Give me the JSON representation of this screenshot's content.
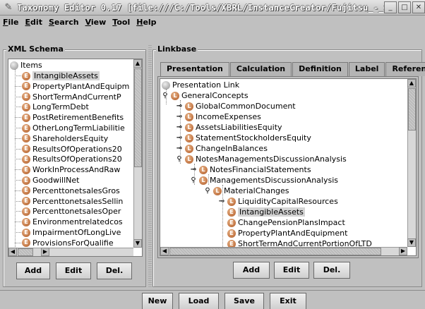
{
  "window": {
    "title": "Taxonomy Editor 0.17 [file:///C:/Tools/XBRL/InstanceCreator/Fujitsu_-_She...",
    "controls": [
      "minimize",
      "maximize",
      "close"
    ]
  },
  "menubar": [
    {
      "label": "File",
      "mnemonic": "F"
    },
    {
      "label": "Edit",
      "mnemonic": "E"
    },
    {
      "label": "Search",
      "mnemonic": "S"
    },
    {
      "label": "View",
      "mnemonic": "V"
    },
    {
      "label": "Tool",
      "mnemonic": "T"
    },
    {
      "label": "Help",
      "mnemonic": "H"
    }
  ],
  "xml_schema": {
    "legend": "XML Schema",
    "root": "Items",
    "items": [
      "IntangibleAssets",
      "PropertyPlantAndEquipm",
      "ShortTermAndCurrentP",
      "LongTermDebt",
      "PostRetirementBenefits",
      "OtherLongTermLiabilitie",
      "ShareholdersEquity",
      "ResultsOfOperations20",
      "ResultsOfOperations20",
      "WorkInProcessAndRaw",
      "GoodwillNet",
      "PercenttonetsalesGros",
      "PercenttonetsalesSellin",
      "PercenttonetsalesOper",
      "Environmentrelatedcos",
      "ImpairmentOfLongLive",
      "ProvisionsForQualifie"
    ],
    "selected": "IntangibleAssets",
    "buttons": {
      "add": "Add",
      "edit": "Edit",
      "del": "Del."
    }
  },
  "linkbase": {
    "legend": "Linkbase",
    "tabs": [
      "Presentation",
      "Calculation",
      "Definition",
      "Label",
      "Reference"
    ],
    "active_tab": "Presentation",
    "tree": {
      "root": "Presentation Link",
      "general": "GeneralConcepts",
      "level1": [
        "GlobalCommonDocument",
        "IncomeExpenses",
        "AssetsLiabilitiesEquity",
        "StatementStockholdersEquity",
        "ChangeInBalances",
        "NotesManagementsDiscussionAnalysis"
      ],
      "notes_financial": "NotesFinancialStatements",
      "mda": "ManagementsDiscussionAnalysis",
      "material_changes": "MaterialChanges",
      "liquidity": "LiquidityCapitalResources",
      "leaves": [
        "IntangibleAssets",
        "ChangePensionPlansImpact",
        "PropertyPlantAndEquipment",
        "ShortTermAndCurrentPortionOfLTD"
      ],
      "selected": "IntangibleAssets"
    },
    "buttons": {
      "add": "Add",
      "edit": "Edit",
      "del": "Del."
    }
  },
  "bottom_buttons": {
    "new": "New",
    "load": "Load",
    "save": "Save",
    "exit": "Exit"
  },
  "node_icon_letters": {
    "element": "E",
    "link": "L"
  }
}
